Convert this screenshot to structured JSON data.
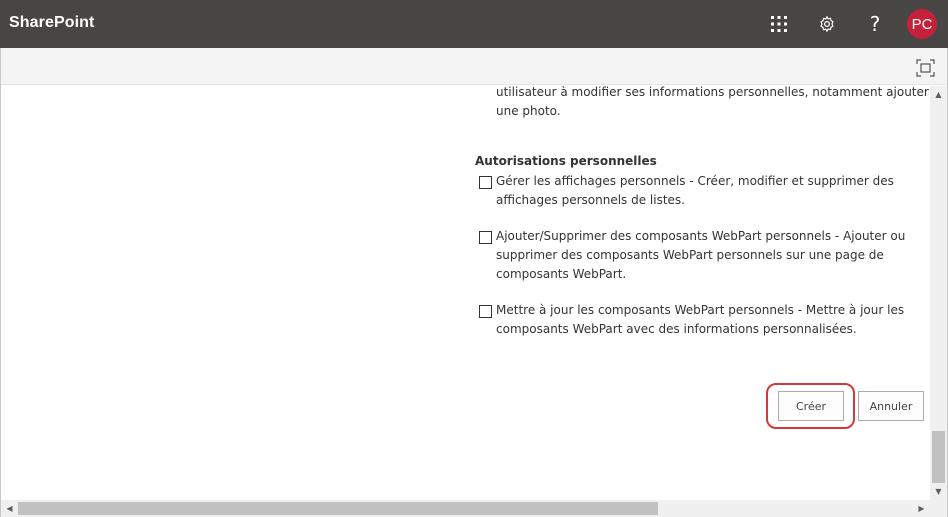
{
  "header": {
    "brand": "SharePoint",
    "help_glyph": "?",
    "avatar_initials": "PC",
    "avatar_color": "#c4213b",
    "bar_color": "#484644",
    "icons": [
      "app-launcher-icon",
      "settings-gear-icon",
      "help-icon"
    ]
  },
  "subbar": {
    "focus_icon": "focus-mode-icon"
  },
  "form": {
    "intro_lines": [
      "utilisateur à modifier ses informations personnelles, notamment ajouter",
      "une photo."
    ],
    "section_title": "Autorisations personnelles",
    "permissions": [
      {
        "checked": false,
        "lines": [
          "Gérer les affichages personnels  -  Créer, modifier et supprimer des",
          "affichages personnels de listes."
        ]
      },
      {
        "checked": false,
        "lines": [
          "Ajouter/Supprimer des composants WebPart personnels  -  Ajouter ou",
          "supprimer des composants WebPart personnels sur une page de",
          "composants WebPart."
        ]
      },
      {
        "checked": false,
        "lines": [
          "Mettre à jour les composants WebPart personnels  -  Mettre à jour les",
          "composants WebPart avec des informations personnalisées."
        ]
      }
    ],
    "buttons": {
      "create": "Créer",
      "cancel": "Annuler"
    },
    "highlight_color": "#d33a3a"
  },
  "scrollbars": {
    "up": "▲",
    "down": "▼",
    "left": "◀",
    "right": "▶"
  }
}
